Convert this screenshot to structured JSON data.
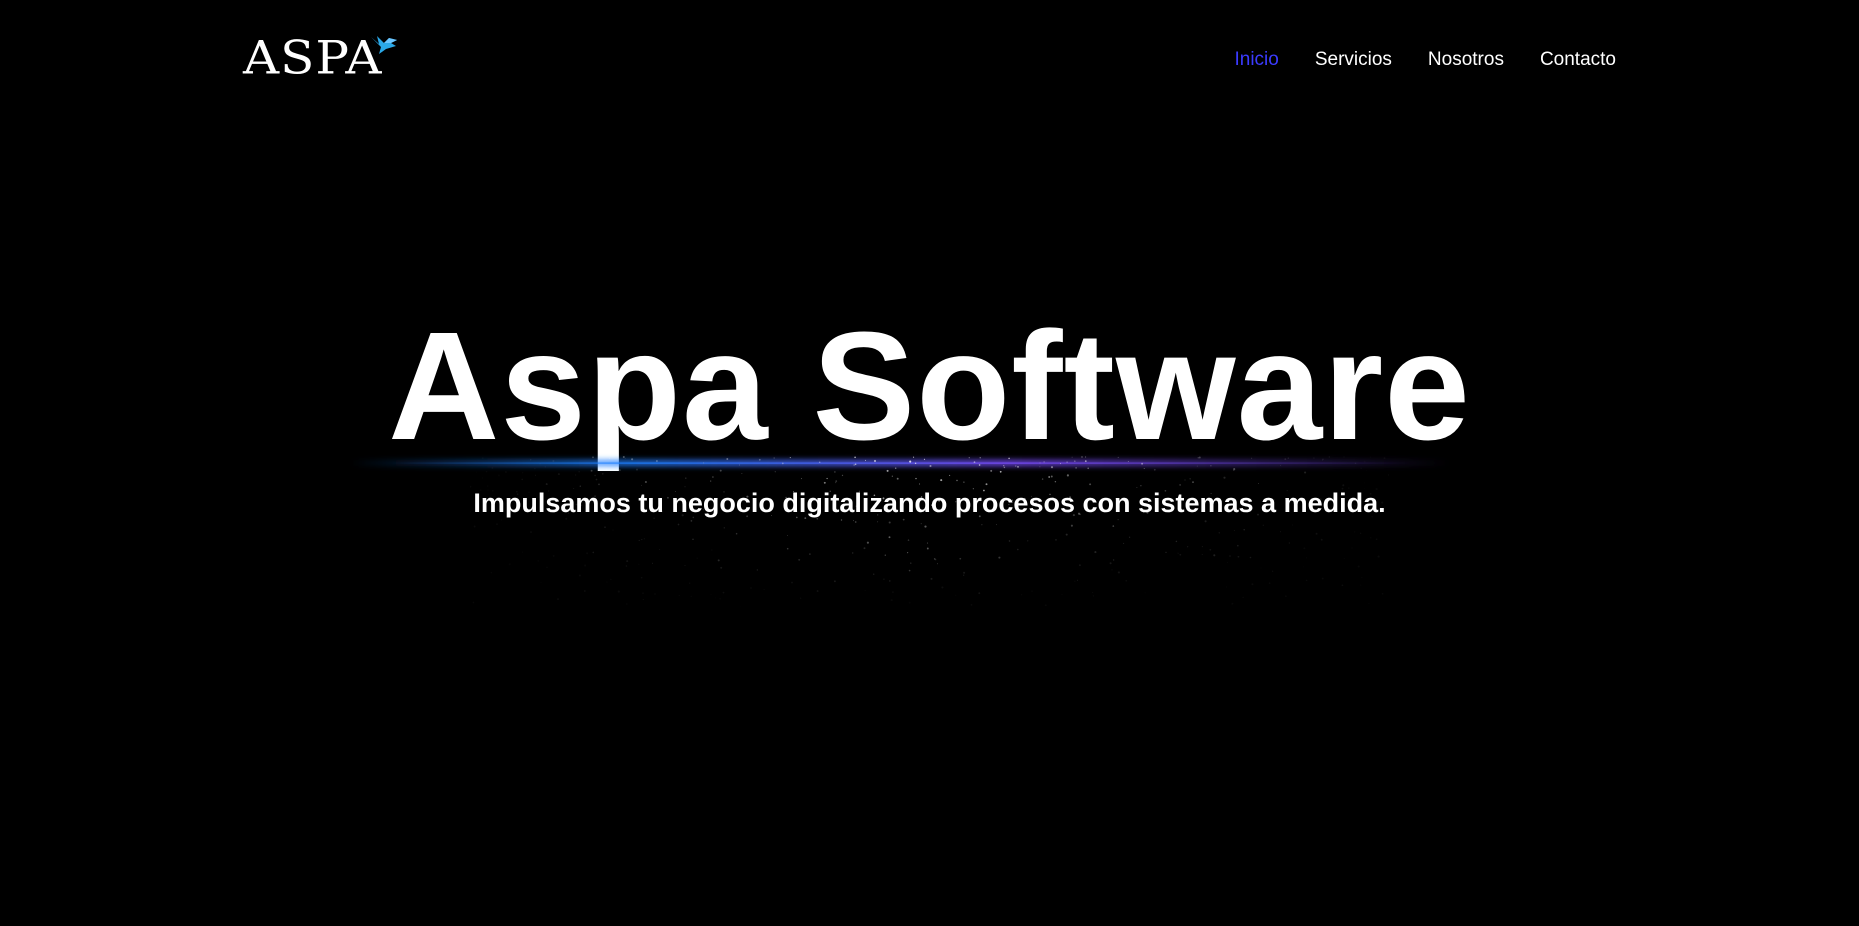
{
  "header": {
    "logo": {
      "text": "ASPA",
      "icon": "bird-icon",
      "accent_color": "#2aa8e8"
    },
    "nav": {
      "items": [
        {
          "label": "Inicio",
          "active": true
        },
        {
          "label": "Servicios",
          "active": false
        },
        {
          "label": "Nosotros",
          "active": false
        },
        {
          "label": "Contacto",
          "active": false
        }
      ],
      "active_color": "#3b3bff",
      "text_color": "#ffffff"
    }
  },
  "hero": {
    "title": "Aspa Software",
    "subtitle": "Impulsamos tu negocio digitalizando procesos con sistemas a medida.",
    "glow_colors": [
      "#1e7fff",
      "#7a4dff"
    ]
  },
  "colors": {
    "background": "#000000",
    "text": "#ffffff"
  }
}
